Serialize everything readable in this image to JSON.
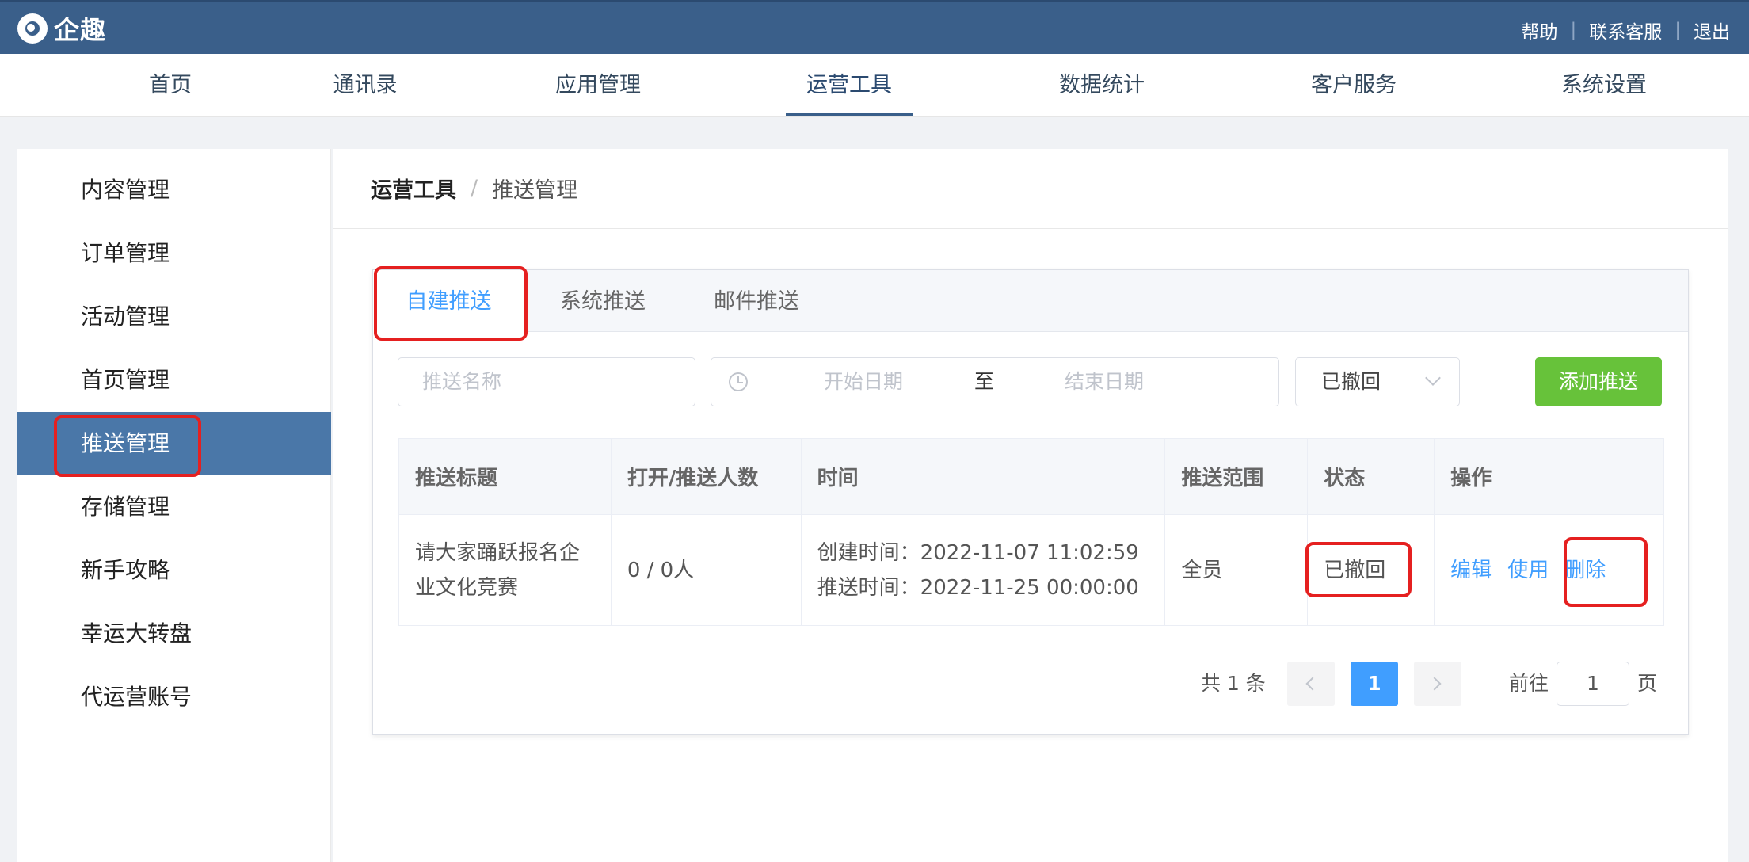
{
  "topbar": {
    "logo_text": "企趣",
    "links": [
      "帮助",
      "联系客服",
      "退出"
    ],
    "separator": "|"
  },
  "nav": {
    "items": [
      "首页",
      "通讯录",
      "应用管理",
      "运营工具",
      "数据统计",
      "客户服务",
      "系统设置"
    ],
    "active": "运营工具"
  },
  "sidebar": {
    "items": [
      "内容管理",
      "订单管理",
      "活动管理",
      "首页管理",
      "推送管理",
      "存储管理",
      "新手攻略",
      "幸运大转盘",
      "代运营账号"
    ],
    "active": "推送管理"
  },
  "breadcrumb": {
    "parent": "运营工具",
    "separator": "/",
    "current": "推送管理"
  },
  "tabs": {
    "items": [
      "自建推送",
      "系统推送",
      "邮件推送"
    ],
    "active": "自建推送"
  },
  "filters": {
    "name_placeholder": "推送名称",
    "start_placeholder": "开始日期",
    "range_separator": "至",
    "end_placeholder": "结束日期",
    "status_value": "已撤回",
    "add_button": "添加推送"
  },
  "table": {
    "headers": [
      "推送标题",
      "打开/推送人数",
      "时间",
      "推送范围",
      "状态",
      "操作"
    ],
    "rows": [
      {
        "title": "请大家踊跃报名企业文化竞赛",
        "count": "0 / 0人",
        "created": "创建时间：2022-11-07 11:02:59",
        "pushed": "推送时间：2022-11-25 00:00:00",
        "scope": "全员",
        "status": "已撤回",
        "actions": [
          "编辑",
          "使用",
          "删除"
        ]
      }
    ]
  },
  "pagination": {
    "total_text": "共 1 条",
    "current_page": "1",
    "goto_label": "前往",
    "goto_value": "1",
    "page_unit": "页"
  },
  "colors": {
    "header_bg": "#3a5f8a",
    "active_sidebar_bg": "#4a77a8",
    "link_blue": "#409eff",
    "add_green": "#67c23a",
    "highlight_red": "#e52020"
  }
}
